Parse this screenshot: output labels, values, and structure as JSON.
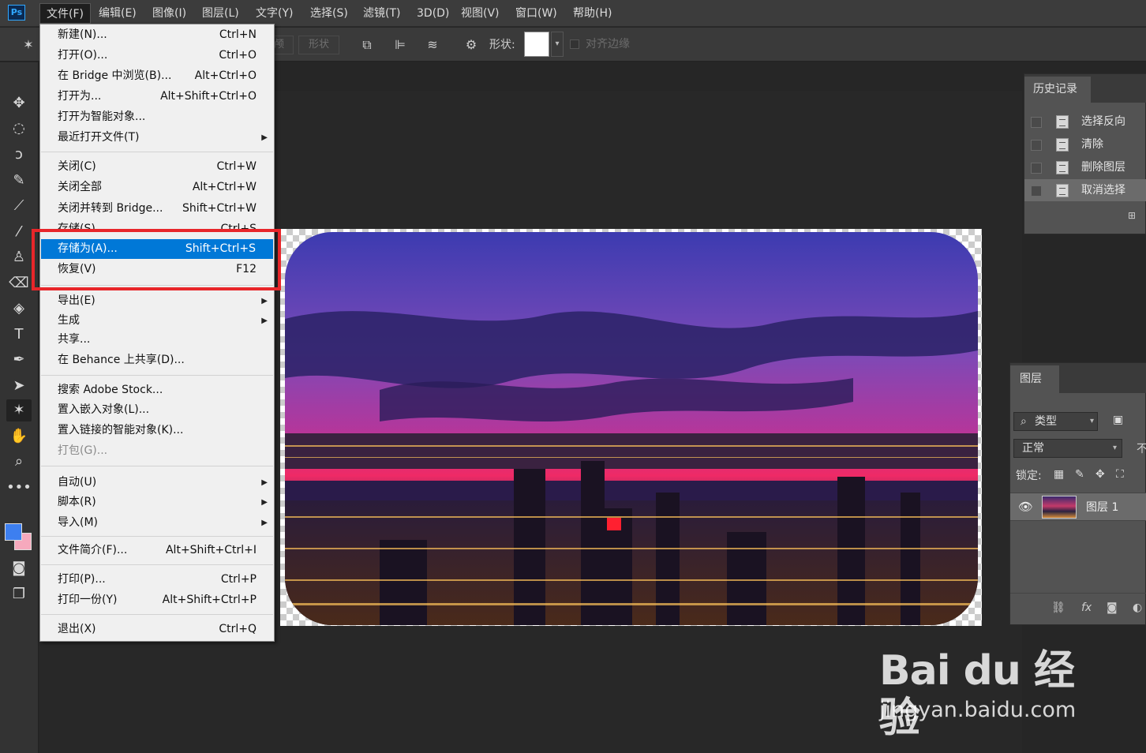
{
  "app": {
    "logo": "Ps"
  },
  "menubar": {
    "items": [
      "文件(F)",
      "编辑(E)",
      "图像(I)",
      "图层(L)",
      "文字(Y)",
      "选择(S)",
      "滤镜(T)",
      "3D(D)",
      "视图(V)",
      "窗口(W)",
      "帮助(H)"
    ],
    "active_index": 0
  },
  "options_bar": {
    "partial_label": "颅",
    "shape_mode_label": "形状",
    "shape_label": "形状:",
    "align_edges_label": "对齐边缘",
    "shape_fill_color": "#ffffff"
  },
  "file_menu": {
    "items": [
      {
        "label": "新建(N)...",
        "shortcut": "Ctrl+N"
      },
      {
        "label": "打开(O)...",
        "shortcut": "Ctrl+O"
      },
      {
        "label": "在 Bridge 中浏览(B)...",
        "shortcut": "Alt+Ctrl+O"
      },
      {
        "label": "打开为...",
        "shortcut": "Alt+Shift+Ctrl+O"
      },
      {
        "label": "打开为智能对象...",
        "shortcut": ""
      },
      {
        "label": "最近打开文件(T)",
        "shortcut": "",
        "submenu": true
      },
      {
        "label": "关闭(C)",
        "shortcut": "Ctrl+W"
      },
      {
        "label": "关闭全部",
        "shortcut": "Alt+Ctrl+W"
      },
      {
        "label": "关闭并转到 Bridge...",
        "shortcut": "Shift+Ctrl+W"
      },
      {
        "label": "存储(S)",
        "shortcut": "Ctrl+S"
      },
      {
        "label": "存储为(A)...",
        "shortcut": "Shift+Ctrl+S",
        "highlighted": true
      },
      {
        "label": "恢复(V)",
        "shortcut": "F12"
      },
      {
        "label": "导出(E)",
        "shortcut": "",
        "submenu": true
      },
      {
        "label": "生成",
        "shortcut": "",
        "submenu": true
      },
      {
        "label": "共享...",
        "shortcut": ""
      },
      {
        "label": "在 Behance 上共享(D)...",
        "shortcut": ""
      },
      {
        "label": "搜索 Adobe Stock...",
        "shortcut": ""
      },
      {
        "label": "置入嵌入对象(L)...",
        "shortcut": ""
      },
      {
        "label": "置入链接的智能对象(K)...",
        "shortcut": ""
      },
      {
        "label": "打包(G)...",
        "shortcut": "",
        "disabled": true
      },
      {
        "label": "自动(U)",
        "shortcut": "",
        "submenu": true
      },
      {
        "label": "脚本(R)",
        "shortcut": "",
        "submenu": true
      },
      {
        "label": "导入(M)",
        "shortcut": "",
        "submenu": true
      },
      {
        "label": "文件简介(F)...",
        "shortcut": "Alt+Shift+Ctrl+I"
      },
      {
        "label": "打印(P)...",
        "shortcut": "Ctrl+P"
      },
      {
        "label": "打印一份(Y)",
        "shortcut": "Alt+Shift+Ctrl+P"
      },
      {
        "label": "退出(X)",
        "shortcut": "Ctrl+Q"
      }
    ]
  },
  "history_panel": {
    "tab": "历史记录",
    "items": [
      "选择反向",
      "清除",
      "删除图层",
      "取消选择"
    ],
    "selected_index": 3
  },
  "layers_panel": {
    "tab": "图层",
    "kind_filter": "类型",
    "blend_mode": "正常",
    "opacity_label_partial": "不",
    "lock_label": "锁定:",
    "layer_name": "图层 1",
    "footer_fx": "fx"
  },
  "colors": {
    "foreground": "#3d7ff0",
    "background": "#f6a9bd",
    "highlight": "#0078d7",
    "callout": "#e8262a"
  },
  "watermark": {
    "main": "Bai du 经验",
    "sub": "jingyan.baidu.com"
  }
}
